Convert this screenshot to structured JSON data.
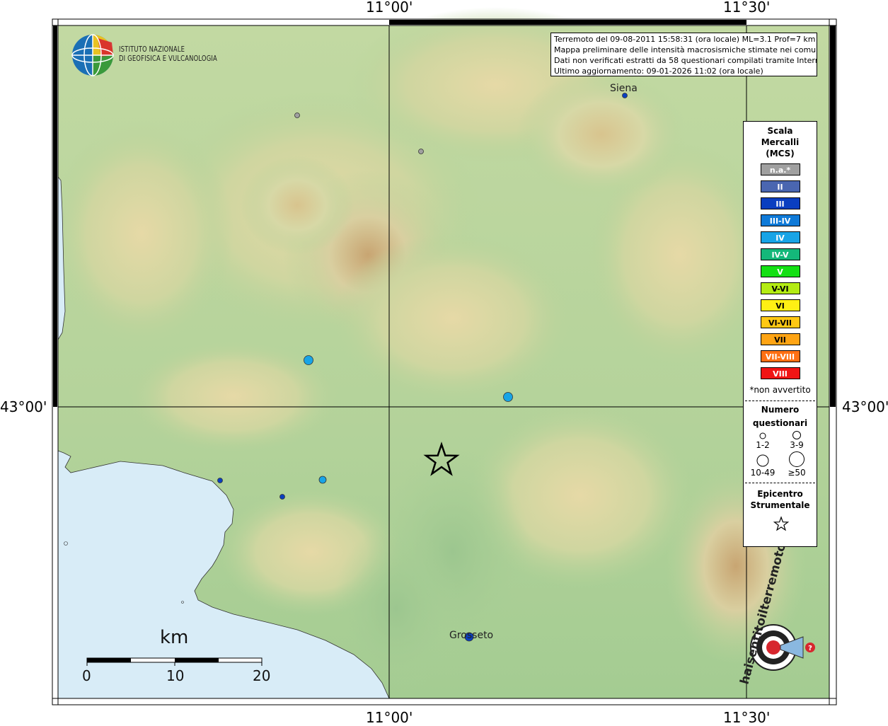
{
  "coordinates": {
    "top_left": "11°00'",
    "top_right": "11°30'",
    "bottom_left": "11°00'",
    "bottom_right": "11°30'",
    "left": "43°00'",
    "right": "43°00'"
  },
  "institute": {
    "line1": "ISTITUTO NAZIONALE",
    "line2": "DI GEOFISICA E VULCANOLOGIA"
  },
  "info": {
    "line1": "Terremoto del 09-08-2011 15:58:31 (ora locale) ML=3.1 Prof=7 km",
    "line2": "Mappa preliminare delle intensità macrosismiche stimate nei comuni",
    "line3": "Dati non verificati estratti da 58 questionari compilati tramite Internet.",
    "line4": "Ultimo aggiornamento: 09-01-2026 11:02 (ora locale)"
  },
  "places": {
    "siena": "Siena",
    "grosseto": "Grosseto"
  },
  "legend": {
    "title1": "Scala",
    "title2": "Mercalli",
    "title3": "(MCS)",
    "scale": [
      {
        "label": "n.a.*",
        "color": "#a0a0a0"
      },
      {
        "label": "II",
        "color": "#4a66b0"
      },
      {
        "label": "III",
        "color": "#0a3ec0"
      },
      {
        "label": "III-IV",
        "color": "#0f7ad8"
      },
      {
        "label": "IV",
        "color": "#18a4e6"
      },
      {
        "label": "IV-V",
        "color": "#14b87a"
      },
      {
        "label": "V",
        "color": "#14e014"
      },
      {
        "label": "V-VI",
        "color": "#b4ec14"
      },
      {
        "label": "VI",
        "color": "#fff014"
      },
      {
        "label": "VI-VII",
        "color": "#ffc814"
      },
      {
        "label": "VII",
        "color": "#ffa414"
      },
      {
        "label": "VII-VIII",
        "color": "#ff7014"
      },
      {
        "label": "VIII",
        "color": "#f01414"
      }
    ],
    "note": "*non avvertito",
    "count_title1": "Numero",
    "count_title2": "questionari",
    "counts": [
      "1-2",
      "3-9",
      "10-49",
      "≥50"
    ],
    "epicenter1": "Epicentro",
    "epicenter2": "Strumentale"
  },
  "scalebar": {
    "unit": "km",
    "ticks": [
      "0",
      "10",
      "20"
    ]
  },
  "logo_text": "www.haisentitoilterremoto.it",
  "colors": {
    "sea": "#d8ecf7",
    "land": "#a9cf96",
    "grid": "#000000",
    "frame": "#000000"
  }
}
